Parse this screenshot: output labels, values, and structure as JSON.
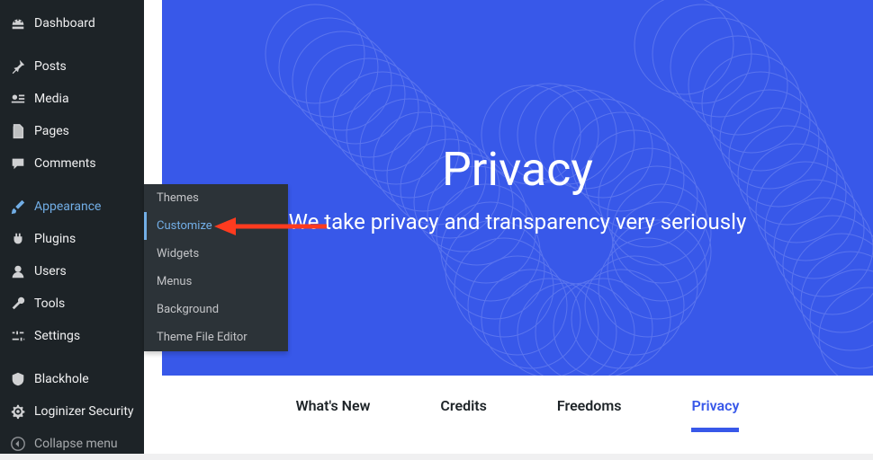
{
  "sidebar": {
    "items": [
      {
        "label": "Dashboard",
        "icon": "dashboard-icon"
      },
      {
        "label": "Posts",
        "icon": "pin-icon"
      },
      {
        "label": "Media",
        "icon": "media-icon"
      },
      {
        "label": "Pages",
        "icon": "pages-icon"
      },
      {
        "label": "Comments",
        "icon": "comment-icon"
      },
      {
        "label": "Appearance",
        "icon": "brush-icon",
        "active": true
      },
      {
        "label": "Plugins",
        "icon": "plug-icon"
      },
      {
        "label": "Users",
        "icon": "user-icon"
      },
      {
        "label": "Tools",
        "icon": "wrench-icon"
      },
      {
        "label": "Settings",
        "icon": "sliders-icon"
      },
      {
        "label": "Blackhole",
        "icon": "shield-icon"
      },
      {
        "label": "Loginizer Security",
        "icon": "gear-icon"
      },
      {
        "label": "Collapse menu",
        "icon": "collapse-icon",
        "muted": true
      }
    ]
  },
  "submenu": {
    "items": [
      {
        "label": "Themes"
      },
      {
        "label": "Customize",
        "active": true
      },
      {
        "label": "Widgets"
      },
      {
        "label": "Menus"
      },
      {
        "label": "Background"
      },
      {
        "label": "Theme File Editor"
      }
    ]
  },
  "hero": {
    "title": "Privacy",
    "subtitle": "We take privacy and transparency very seriously"
  },
  "tabs": {
    "items": [
      {
        "label": "What's New"
      },
      {
        "label": "Credits"
      },
      {
        "label": "Freedoms"
      },
      {
        "label": "Privacy",
        "active": true
      }
    ]
  }
}
